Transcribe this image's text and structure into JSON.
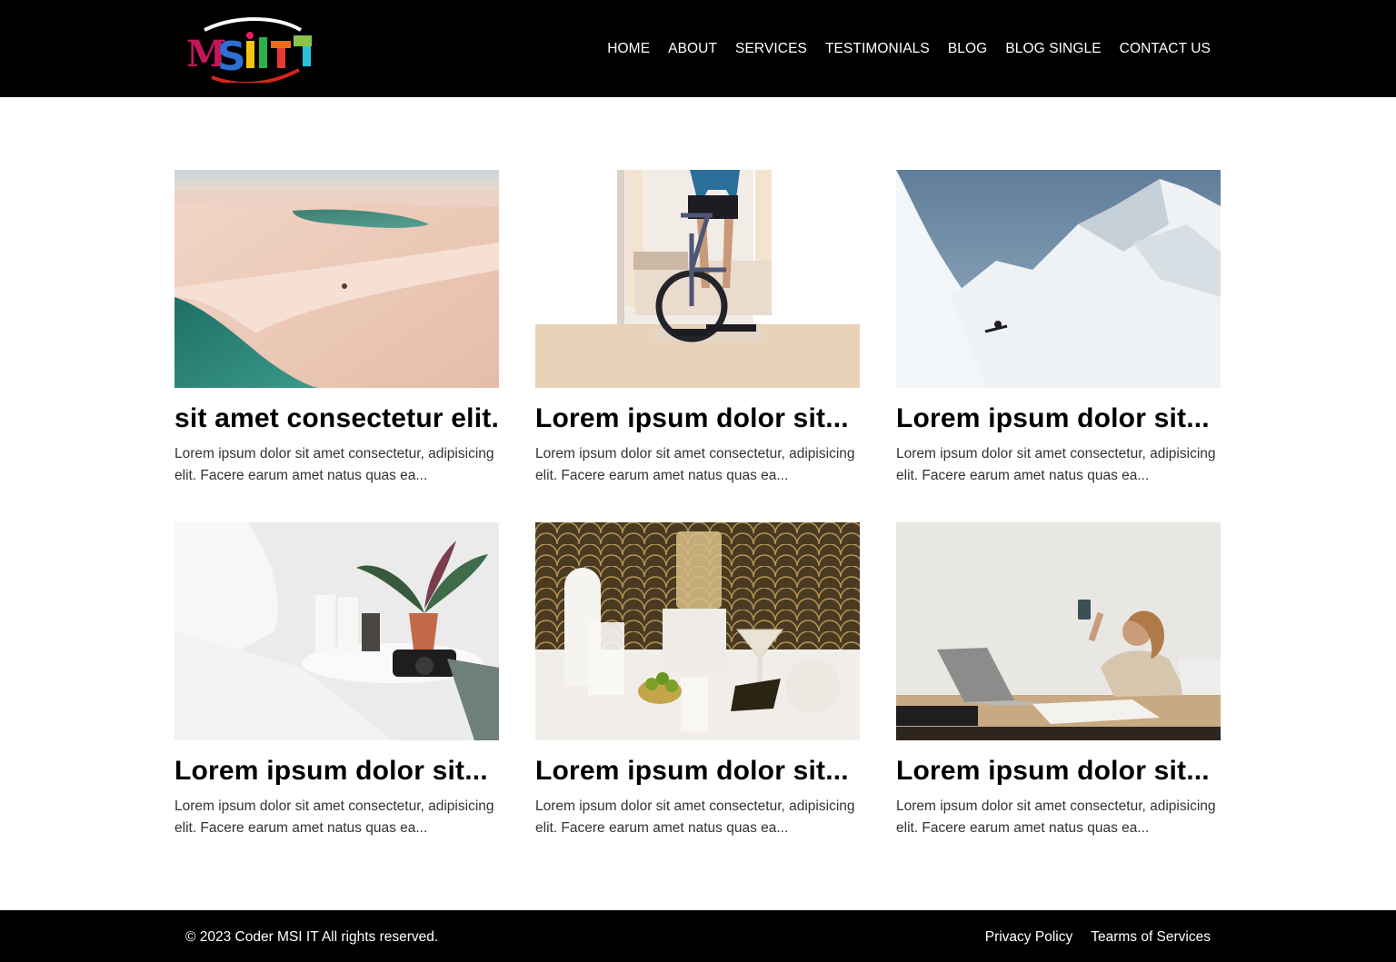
{
  "header": {
    "logo_text": "MSIIT",
    "nav": [
      "HOME",
      "ABOUT",
      "SERVICES",
      "TESTIMONIALS",
      "BLOG",
      "BLOG SINGLE",
      "CONTACT US"
    ]
  },
  "cards": [
    {
      "title": "sit amet consectetur elit.",
      "excerpt": "Lorem ipsum dolor sit amet consectetur, adipisicing elit. Facere earum amet natus quas ea...",
      "image": "desert-lagoon-dunes"
    },
    {
      "title": "Lorem ipsum dolor sit...",
      "excerpt": "Lorem ipsum dolor sit amet consectetur, adipisicing elit. Facere earum amet natus quas ea...",
      "image": "indoor-cycling-trainer"
    },
    {
      "title": "Lorem ipsum dolor sit...",
      "excerpt": "Lorem ipsum dolor sit amet consectetur, adipisicing elit. Facere earum amet natus quas ea...",
      "image": "snowboarder-mountain"
    },
    {
      "title": "Lorem ipsum dolor sit...",
      "excerpt": "Lorem ipsum dolor sit amet consectetur, adipisicing elit. Facere earum amet natus quas ea...",
      "image": "bedside-table-plant-camera"
    },
    {
      "title": "Lorem ipsum dolor sit...",
      "excerpt": "Lorem ipsum dolor sit amet consectetur, adipisicing elit. Facere earum amet natus quas ea...",
      "image": "glassware-still-life"
    },
    {
      "title": "Lorem ipsum dolor sit...",
      "excerpt": "Lorem ipsum dolor sit amet consectetur, adipisicing elit. Facere earum amet natus quas ea...",
      "image": "woman-at-desk-laptop"
    }
  ],
  "footer": {
    "copyright": "© 2023 Coder MSI IT All rights reserved.",
    "links": [
      "Privacy Policy",
      "Tearms of Services"
    ]
  },
  "colors": {
    "header_bg": "#000000",
    "footer_bg": "#000000",
    "text_light": "#ffffff",
    "title": "#000000"
  }
}
